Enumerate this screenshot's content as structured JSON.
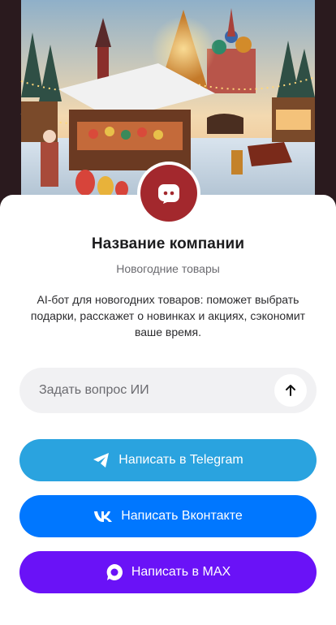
{
  "company": {
    "name": "Название компании",
    "subtitle": "Новогодние товары",
    "description": "AI-бот для новогодних товаров: поможет выбрать подарки, расскажет о новинках и акциях, сэкономит ваше время."
  },
  "ask": {
    "placeholder": "Задать вопрос ИИ",
    "value": ""
  },
  "buttons": {
    "telegram": {
      "label": "Написать в Telegram",
      "icon": "telegram-icon",
      "color": "#2aa3df"
    },
    "vk": {
      "label": "Написать Вконтакте",
      "icon": "vk-icon",
      "color": "#0077ff"
    },
    "max": {
      "label": "Написать в MAX",
      "icon": "max-icon",
      "color": "#6a12f7"
    }
  },
  "colors": {
    "brand": "#a3282d",
    "accent": "#2aa3df"
  }
}
